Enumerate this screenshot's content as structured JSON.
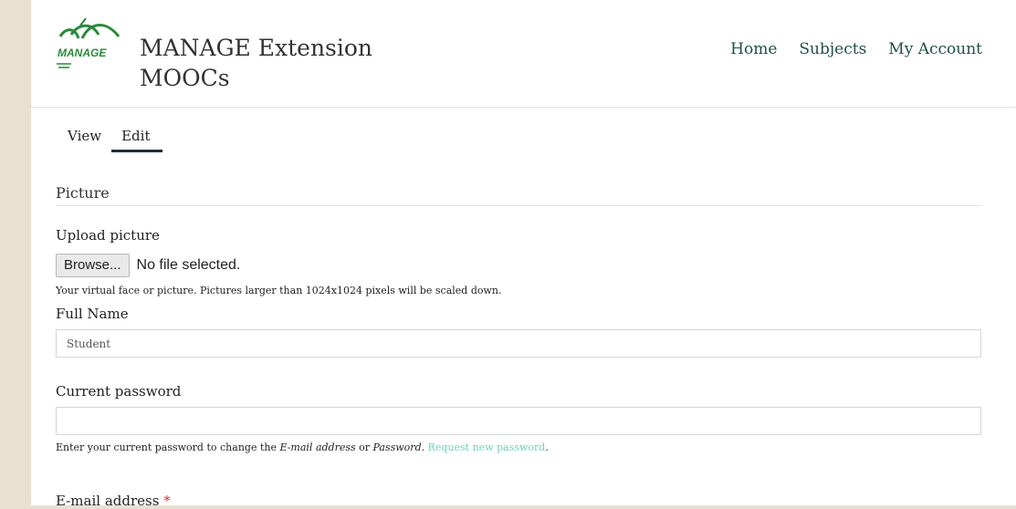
{
  "header": {
    "logo_text": "MANAGE",
    "site_name_line1": "MANAGE Extension",
    "site_name_line2": "MOOCs",
    "nav": [
      "Home",
      "Subjects",
      "My Account"
    ]
  },
  "tabs": [
    "View",
    "Edit"
  ],
  "section": {
    "title": "Picture"
  },
  "upload": {
    "label": "Upload picture",
    "browse_label": "Browse...",
    "file_status": "No file selected.",
    "help": "Your virtual face or picture. Pictures larger than 1024x1024 pixels will be scaled down."
  },
  "full_name": {
    "label": "Full Name",
    "value": "Student"
  },
  "current_password": {
    "label": "Current password",
    "value": "",
    "help_prefix": "Enter your current password to change the ",
    "help_email": "E-mail address",
    "help_or": " or ",
    "help_password": "Password",
    "help_dot": ". ",
    "help_link": "Request new password",
    "help_end": "."
  },
  "email": {
    "label": "E-mail address ",
    "required_mark": "*"
  },
  "colors": {
    "accent": "#1f4f4a",
    "link": "#6fd0be",
    "sidebar_bg": "#e9e0d0"
  }
}
